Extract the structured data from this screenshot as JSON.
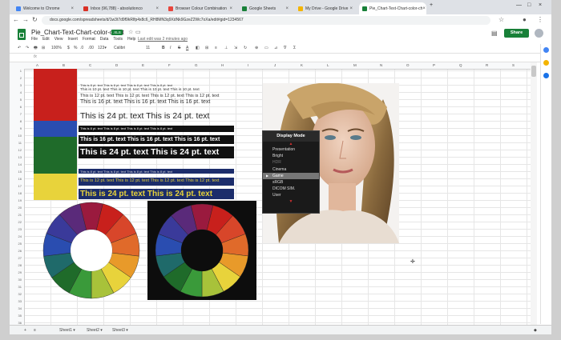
{
  "browser": {
    "tabs": [
      {
        "title": "Welcome to Chrome",
        "color": "#4285f4"
      },
      {
        "title": "Inbox (96,788) - absolutionco",
        "color": "#d93025"
      },
      {
        "title": "Browser Colour Combination",
        "color": "#e8453c"
      },
      {
        "title": "Google Sheets",
        "color": "#188038"
      },
      {
        "title": "My Drive - Google Drive",
        "color": "#f4b400"
      },
      {
        "title": "Pie_Chart-Text-Chart-color-ch",
        "color": "#188038"
      }
    ],
    "new_tab": "+",
    "url": "docs.google.com/spreadsheets/d/1w3t7d9f9kRlfp4x8c6_RH8MN3q9XdNk9GzeZ2Wc7oXa/edit#gid=1234567"
  },
  "doc": {
    "title": "Pie_Chart-Text-Chart-color-chart",
    "badge": ".XLS",
    "menu": [
      "File",
      "Edit",
      "View",
      "Insert",
      "Format",
      "Data",
      "Tools",
      "Help"
    ],
    "last_edit": "Last edit was 2 minutes ago",
    "share": "Share",
    "toolbar": [
      "↶",
      "↷",
      "🖶",
      "⊞",
      "100%",
      "$",
      "%",
      ".0",
      ".00",
      "123▾",
      "Calibri",
      "11",
      "B",
      "I",
      "S",
      "A",
      "◧",
      "⊞",
      "≡",
      "⊥",
      "⇲",
      "↻",
      "⊕",
      "▭",
      "⊿",
      "∇",
      "Σ"
    ],
    "fx": "fx"
  },
  "grid": {
    "columns": [
      "A",
      "B",
      "C",
      "D",
      "E",
      "F",
      "G",
      "H",
      "I",
      "J",
      "K",
      "L",
      "M",
      "N",
      "O",
      "P",
      "Q",
      "R",
      "S"
    ],
    "row_numbers": [
      "1",
      "2",
      "3",
      "4",
      "5",
      "6",
      "7",
      "8",
      "9",
      "10",
      "11",
      "12",
      "13",
      "14",
      "15",
      "16",
      "17",
      "18",
      "19",
      "20",
      "21",
      "22",
      "23",
      "24",
      "25",
      "26",
      "27",
      "28",
      "29",
      "30",
      "31",
      "32",
      "33",
      "34",
      "35",
      "36"
    ]
  },
  "samples": {
    "small_8": "This is 8 pt. text   This is 8 pt. text   This is 8 pt. text   This is 8 pt. text",
    "small_10": "This is 10 pt. text   This is 10 pt. text   This is 10 pt. text   This is 10 pt. text",
    "mid_12": "This is 12 pt. text   This is 12 pt. text   This is 12 pt. text   This is 12 pt. text",
    "mid_16": "This is 16 pt. text   This is 16 pt. text   This is 16 pt. text",
    "big_24": "This is 24 pt. text   This is 24 pt. text"
  },
  "swatches": [
    "#c8201c",
    "#2a4db0",
    "#1f6b2a",
    "#e8d33b"
  ],
  "bands": {
    "black": "#111111",
    "navy": "#1c2d6b"
  },
  "wheel_colors": [
    "#9a1a3e",
    "#c8201c",
    "#d8462a",
    "#e06a2a",
    "#e89a2a",
    "#e8d33b",
    "#a8c23a",
    "#3a9a3a",
    "#1f6b2a",
    "#1f6a6a",
    "#2a4db0",
    "#3a3a9a",
    "#5a2a7a"
  ],
  "osd": {
    "title": "Display Mode",
    "items": [
      {
        "label": "Presentation",
        "state": "normal"
      },
      {
        "label": "Bright",
        "state": "normal"
      },
      {
        "label": "HDR",
        "state": "dim"
      },
      {
        "label": "Cinema",
        "state": "normal"
      },
      {
        "label": "Game",
        "state": "selected"
      },
      {
        "label": "sRGB",
        "state": "normal"
      },
      {
        "label": "DICOM SIM.",
        "state": "normal"
      },
      {
        "label": "User",
        "state": "normal"
      }
    ]
  },
  "sheets": {
    "add": "+",
    "list": "≡",
    "tabs": [
      "Sheet1 ▾",
      "Sheet2 ▾",
      "Sheet3 ▾"
    ]
  }
}
